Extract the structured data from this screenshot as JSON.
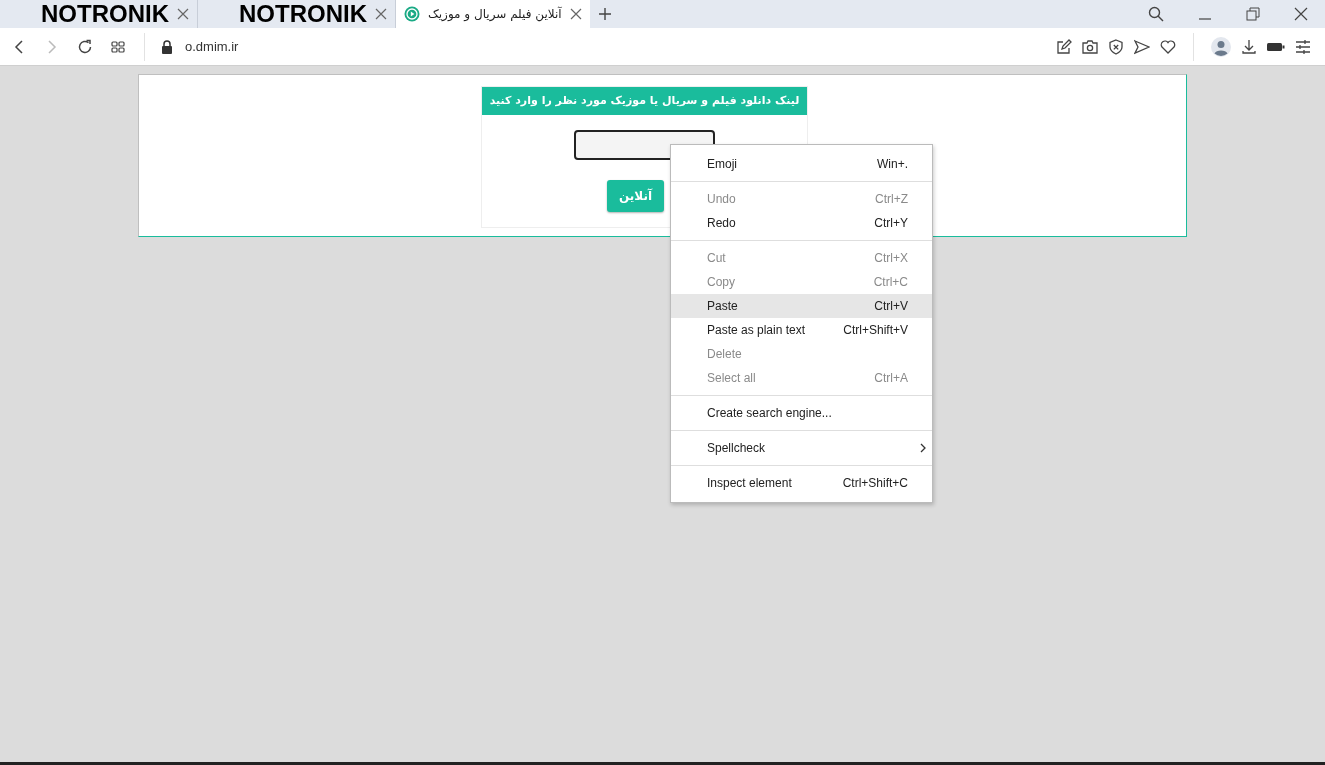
{
  "tabs": [
    {
      "title": "NOTRONIK",
      "selected": false,
      "kind": "logo"
    },
    {
      "title": "NOTRONIK",
      "selected": false,
      "kind": "logo"
    },
    {
      "title": "آنلاین فیلم سریال و موزیک",
      "selected": true,
      "kind": "page"
    }
  ],
  "address": {
    "url": "o.dmim.ir"
  },
  "form": {
    "heading": "لینک دانلود فیلم و سریال یا موزیک مورد نظر را وارد کنید",
    "button": "آنلاین"
  },
  "context_menu": [
    {
      "kind": "item",
      "label": "Emoji",
      "shortcut": "Win+.",
      "disabled": false,
      "selected": false
    },
    {
      "kind": "separator"
    },
    {
      "kind": "item",
      "label": "Undo",
      "shortcut": "Ctrl+Z",
      "disabled": true,
      "selected": false
    },
    {
      "kind": "item",
      "label": "Redo",
      "shortcut": "Ctrl+Y",
      "disabled": false,
      "selected": false
    },
    {
      "kind": "separator"
    },
    {
      "kind": "item",
      "label": "Cut",
      "shortcut": "Ctrl+X",
      "disabled": true,
      "selected": false
    },
    {
      "kind": "item",
      "label": "Copy",
      "shortcut": "Ctrl+C",
      "disabled": true,
      "selected": false
    },
    {
      "kind": "item",
      "label": "Paste",
      "shortcut": "Ctrl+V",
      "disabled": false,
      "selected": true
    },
    {
      "kind": "item",
      "label": "Paste as plain text",
      "shortcut": "Ctrl+Shift+V",
      "disabled": false,
      "selected": false
    },
    {
      "kind": "item",
      "label": "Delete",
      "disabled": true,
      "selected": false
    },
    {
      "kind": "item",
      "label": "Select all",
      "shortcut": "Ctrl+A",
      "disabled": true,
      "selected": false
    },
    {
      "kind": "separator"
    },
    {
      "kind": "item",
      "label": "Create search engine...",
      "disabled": false,
      "selected": false
    },
    {
      "kind": "separator"
    },
    {
      "kind": "submenu",
      "label": "Spellcheck",
      "disabled": false,
      "selected": false
    },
    {
      "kind": "separator"
    },
    {
      "kind": "item",
      "label": "Inspect element",
      "shortcut": "Ctrl+Shift+C",
      "disabled": false,
      "selected": false
    }
  ]
}
